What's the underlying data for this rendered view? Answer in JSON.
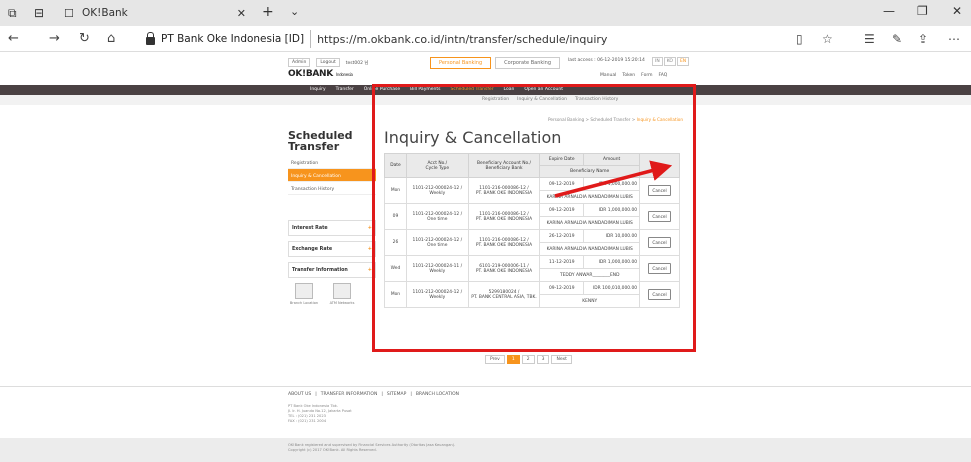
{
  "browser": {
    "tab_title": "OK!Bank",
    "cert": "PT Bank Oke Indonesia [ID]",
    "url": "https://m.okbank.co.id/intn/transfer/schedule/inquiry"
  },
  "header": {
    "admin": "Admin",
    "logout": "Logout",
    "user": "test002 님",
    "personal": "Personal Banking",
    "corporate": "Corporate Banking",
    "last_access": "last access : 06-12-2019 15:20:14",
    "lang": [
      "IN",
      "KO",
      "EN"
    ],
    "logo": "OK!BANK",
    "logo_sub": "Indonesia",
    "utils": [
      "Manual",
      "Token",
      "Form",
      "FAQ"
    ]
  },
  "menu": [
    "Inquiry",
    "Transfer",
    "Online Purchase",
    "Bill Payments",
    "Scheduled Transfer",
    "Loan",
    "Open an Account"
  ],
  "submenu": [
    "Registration",
    "Inquiry & Cancellation",
    "Transaction History"
  ],
  "breadcrumb": {
    "a": "Personal Banking",
    "b": "Scheduled Transfer",
    "c": "Inquiry & Cancellation"
  },
  "sidebar": {
    "title": "Scheduled Transfer",
    "items": [
      "Registration",
      "Inquiry & Cancellation",
      "Transaction History"
    ],
    "boxes": [
      "Interest Rate",
      "Exchange Rate",
      "Transfer Information"
    ],
    "icons": [
      "Branch Location",
      "ATM Networks"
    ]
  },
  "main": {
    "title": "Inquiry & Cancellation"
  },
  "table": {
    "headers": {
      "date": "Date",
      "acct": "Acct No./",
      "cycle": "Cycle Type",
      "ben_acct": "Beneficiary Account No./",
      "ben_bank": "Beneficiary Bank",
      "expire": "Expire Date",
      "amount": "Amount",
      "ben_name": "Beneficiary Name"
    },
    "rows": [
      {
        "date": "Mon",
        "acct": "1101-212-000024-12 /",
        "cycle": "Weekly",
        "ben_acct": "1101-216-000086-12 /",
        "ben_bank": "PT. BANK OKE INDONESIA",
        "expire": "09-12-2019",
        "amount": "IDR 1,000,000.00",
        "name": "KARINA ARNALDIA NANDADIMAN LUBIS",
        "cancel": "Cancel"
      },
      {
        "date": "09",
        "acct": "1101-212-000024-12 /",
        "cycle": "One time",
        "ben_acct": "1101-216-000086-12 /",
        "ben_bank": "PT. BANK OKE INDONESIA",
        "expire": "09-12-2019",
        "amount": "IDR 1,000,000.00",
        "name": "KARINA ARNALDIA NANDADIMAN LUBIS",
        "cancel": "Cancel"
      },
      {
        "date": "26",
        "acct": "1101-212-000024-12 /",
        "cycle": "One time",
        "ben_acct": "1101-216-000086-12 /",
        "ben_bank": "PT. BANK OKE INDONESIA",
        "expire": "26-12-2019",
        "amount": "IDR 10,000.00",
        "name": "KARINA ARNALDIA NANDADIMAN LUBIS",
        "cancel": "Cancel"
      },
      {
        "date": "Wed",
        "acct": "1101-212-000024-11 /",
        "cycle": "Weekly",
        "ben_acct": "6101-219-000006-11 /",
        "ben_bank": "PT. BANK OKE INDONESIA",
        "expire": "11-12-2019",
        "amount": "IDR 1,000,000.00",
        "name": "TEDDY ANWAR________END",
        "cancel": "Cancel"
      },
      {
        "date": "Mon",
        "acct": "1101-212-000024-12 /",
        "cycle": "Weekly",
        "ben_acct": "5299180024 /",
        "ben_bank": "PT. BANK CENTRAL ASIA, TBK.",
        "expire": "09-12-2019",
        "amount": "IDR 100,010,000.00",
        "name": "KENNY",
        "cancel": "Cancel"
      }
    ]
  },
  "pager": {
    "prev": "Prev",
    "pages": [
      "1",
      "2",
      "3"
    ],
    "next": "Next"
  },
  "footer": {
    "links": [
      "ABOUT US",
      "TRANSFER INFORMATION",
      "SITEMAP",
      "BRANCH LOCATION"
    ],
    "address": [
      "PT Bank Oke Indonesia Tbk.",
      "Jl. Ir. H. Juanda No.12, Jakarta Pusat",
      "TEL : (021) 231 2023",
      "FAX : (021) 231 2004"
    ],
    "copy": [
      "OK!Bank registered and supervised by Financial Services Authority (Otoritas Jasa Keuangan).",
      "Copyright (c) 2017 OK!Bank. All Rights Reserved."
    ]
  },
  "colors": {
    "accent": "#f7941d",
    "highlight": "#e01a1a",
    "menubar": "#4a4143"
  }
}
